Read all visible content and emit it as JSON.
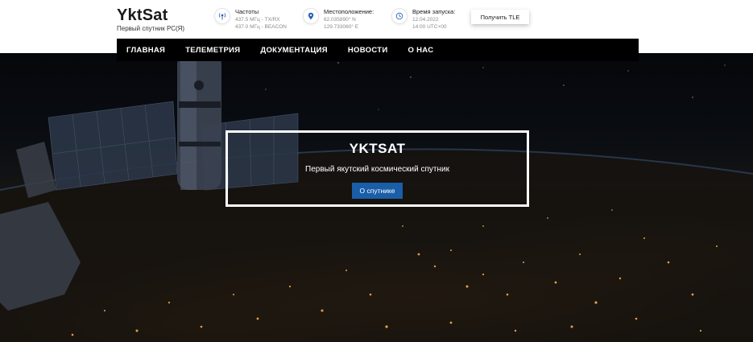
{
  "site": {
    "title": "YktSat",
    "subtitle": "Первый спутник РС(Я)"
  },
  "info": [
    {
      "icon": "satellite-dish-icon",
      "title": "Частоты",
      "lines": [
        "437.5 МГц - TX/RX",
        "437.0 МГц - BEACON"
      ]
    },
    {
      "icon": "map-pin-icon",
      "title": "Местоположение:",
      "lines": [
        "62.035890° N",
        "129.733060° E"
      ]
    },
    {
      "icon": "clock-icon",
      "title": "Время запуска:",
      "lines": [
        "12.04.2022",
        "14:00 UTC+00"
      ]
    }
  ],
  "tle_button": "Получить TLE",
  "nav": [
    "ГЛАВНАЯ",
    "ТЕЛЕМЕТРИЯ",
    "ДОКУМЕНТАЦИЯ",
    "НОВОСТИ",
    "О НАС"
  ],
  "hero": {
    "title": "YKTSAT",
    "subtitle": "Первый якутский космический спутник",
    "button": "О спутнике"
  },
  "colors": {
    "nav_bg": "#000000",
    "accent_blue": "#1a5ea8",
    "icon_blue": "#2a63b8"
  }
}
